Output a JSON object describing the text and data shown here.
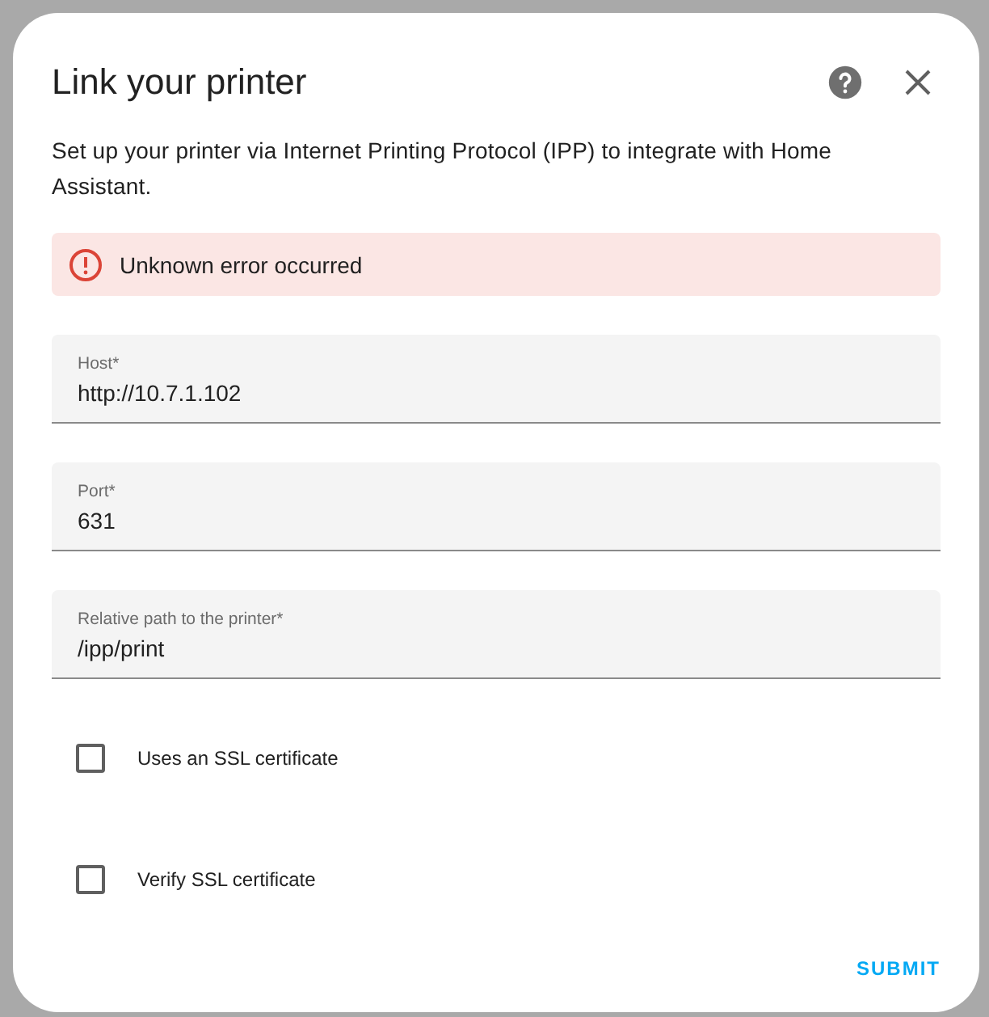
{
  "dialog": {
    "title": "Link your printer",
    "description": "Set up your printer via Internet Printing Protocol (IPP) to integrate with Home Assistant.",
    "error": "Unknown error occurred",
    "fields": [
      {
        "label": "Host*",
        "value": "http://10.7.1.102"
      },
      {
        "label": "Port*",
        "value": "631"
      },
      {
        "label": "Relative path to the printer*",
        "value": "/ipp/print"
      }
    ],
    "checkboxes": [
      {
        "label": "Uses an SSL certificate",
        "checked": false
      },
      {
        "label": "Verify SSL certificate",
        "checked": false
      }
    ],
    "submit": "SUBMIT"
  }
}
